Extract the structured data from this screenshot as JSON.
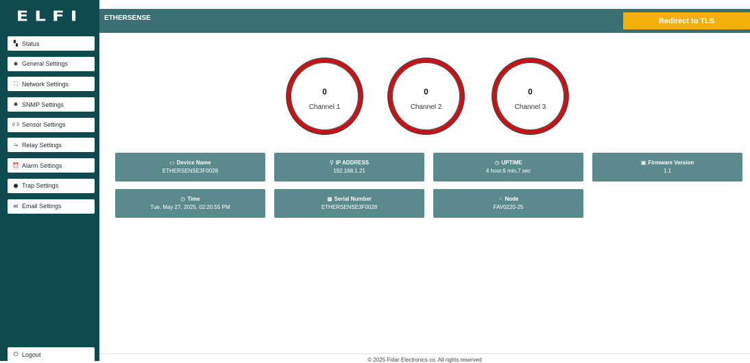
{
  "brand": {
    "logo_text": "ELFI"
  },
  "header": {
    "title": "ETHERSENSE",
    "redirect_label": "Redirect to TLS",
    "redirect_color": "#f2b008",
    "bar_color": "#3a6f73"
  },
  "sidebar": {
    "background": "#0f4a4e",
    "items": [
      {
        "label": "Status",
        "icon": "dashboard-icon",
        "glyph": "▚"
      },
      {
        "label": "General Settings",
        "icon": "gear-icon",
        "glyph": "✱"
      },
      {
        "label": "Network Settings",
        "icon": "network-icon",
        "glyph": "⛶"
      },
      {
        "label": "SNMP Settings",
        "icon": "snmp-icon",
        "glyph": "✺"
      },
      {
        "label": "Sensor Settings",
        "icon": "sensor-icon",
        "glyph": "((·))"
      },
      {
        "label": "Relay Settings",
        "icon": "relay-icon",
        "glyph": "⥲"
      },
      {
        "label": "Alarm Settings",
        "icon": "alarm-icon",
        "glyph": "⏰"
      },
      {
        "label": "Trap Settings",
        "icon": "trap-icon",
        "glyph": "⬣"
      },
      {
        "label": "Email Settings",
        "icon": "envelope-icon",
        "glyph": "✉"
      }
    ],
    "logout": {
      "label": "Logout",
      "icon": "power-icon",
      "glyph": "⏻"
    }
  },
  "gauges": [
    {
      "value": "0",
      "label": "Channel 1"
    },
    {
      "value": "0",
      "label": "Channel 2"
    },
    {
      "value": "0",
      "label": "Channel 3"
    }
  ],
  "gauge_ring_color": "#c41418",
  "info_cards": [
    {
      "title": "Device Name",
      "value": "ETHERSENSE3F0028",
      "icon": "monitor-icon",
      "glyph": "▭"
    },
    {
      "title": "IP ADDRESS",
      "value": "192.168.1.21",
      "icon": "pin-icon",
      "glyph": "⚲"
    },
    {
      "title": "UPTIME",
      "value": "4 hour,6 min,7 sec",
      "icon": "clock-icon",
      "glyph": "◷"
    },
    {
      "title": "Firmware Version",
      "value": "1.1",
      "icon": "firmware-icon",
      "glyph": "▣"
    },
    {
      "title": "Time",
      "value": "Tue, May 27, 2025, 02:20:55 PM",
      "icon": "clock-icon",
      "glyph": "◷"
    },
    {
      "title": "Serial Number",
      "value": "ETHERSENSE3F0028",
      "icon": "barcode-icon",
      "glyph": "▦"
    },
    {
      "title": "Node",
      "value": "FAV0220-25",
      "icon": "node-icon",
      "glyph": "⁘"
    }
  ],
  "card_color": "#5a8a8c",
  "footer": {
    "text": "© 2025 Fidar Electronics co. All rights reserved"
  }
}
